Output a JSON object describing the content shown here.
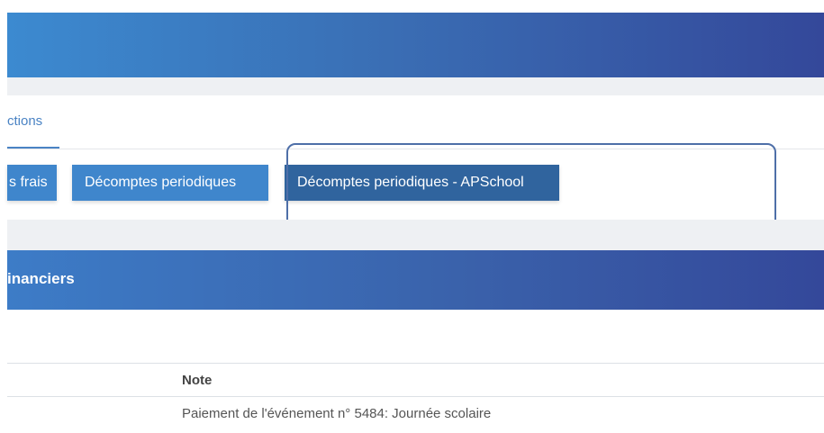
{
  "tabs": {
    "active_label": "ctions"
  },
  "buttons": {
    "frais": "s frais",
    "periodiques": "Décomptes periodiques",
    "apschool": "Décomptes periodiques - APSchool"
  },
  "section": {
    "title": "inanciers"
  },
  "table": {
    "columns": [
      "Note"
    ],
    "rows": [
      {
        "note": "Paiement de l'événement n° 5484: Journée scolaire"
      }
    ]
  },
  "colors": {
    "header_gradient_start": "#3c8ad0",
    "header_gradient_end": "#34489a",
    "button_blue": "#3f86cc",
    "button_active": "#30649e",
    "highlight_border": "#4e6fa8",
    "tab_accent": "#4a83c4"
  }
}
